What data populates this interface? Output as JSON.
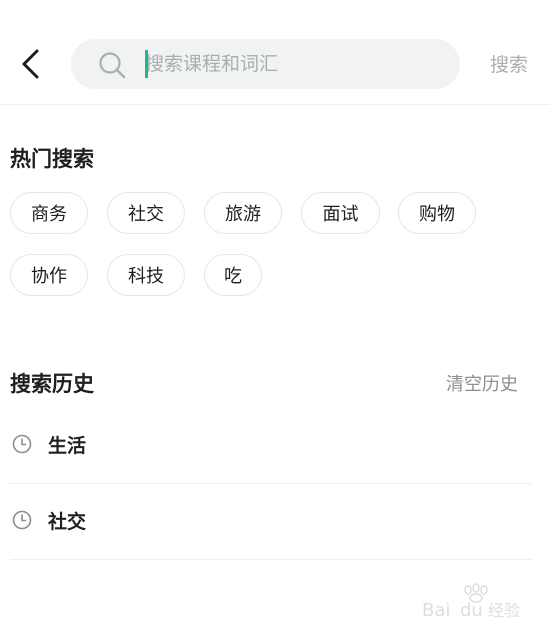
{
  "header": {
    "search_placeholder": "搜索课程和词汇",
    "search_value": "",
    "search_button_label": "搜索"
  },
  "hot_search": {
    "title": "热门搜索",
    "tags": [
      "商务",
      "社交",
      "旅游",
      "面试",
      "购物",
      "协作",
      "科技",
      "吃"
    ]
  },
  "history": {
    "title": "搜索历史",
    "clear_label": "清空历史",
    "items": [
      "生活",
      "社交"
    ]
  },
  "colors": {
    "accent": "#1fb790",
    "search_bg": "#f1f3f3",
    "muted_text": "#a9aeb0",
    "tag_border": "#e6e6e6"
  },
  "icons": {
    "back": "chevron-left-icon",
    "search": "search-icon",
    "history": "clock-icon"
  },
  "watermark": "Baidu 经验"
}
